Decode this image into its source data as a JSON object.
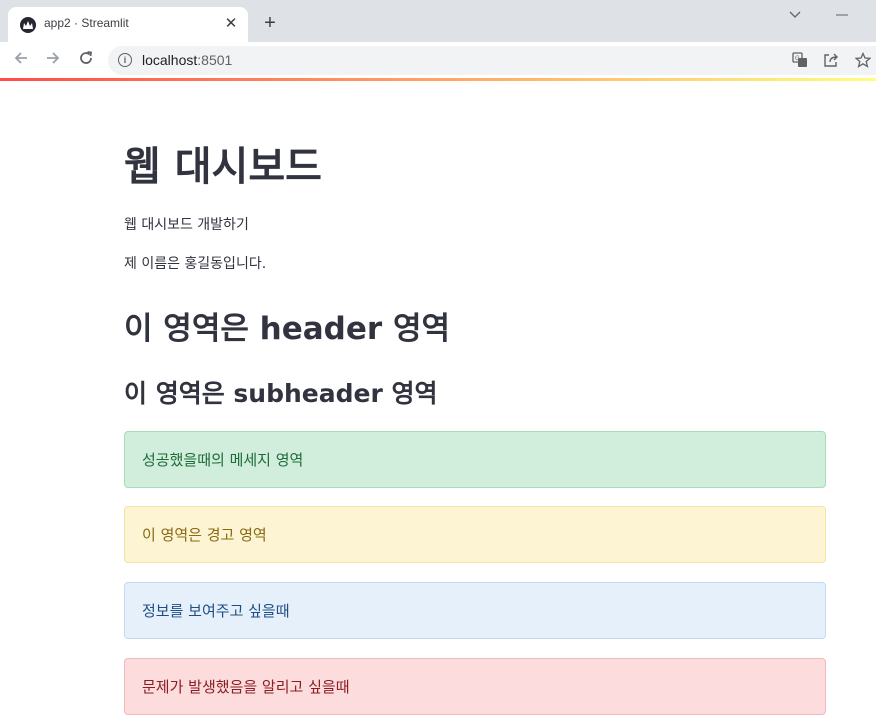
{
  "browser": {
    "tab_title": "app2 · Streamlit",
    "tab_close": "✕",
    "new_tab": "+",
    "url_host": "localhost",
    "url_port": ":8501"
  },
  "content": {
    "title": "웹 대시보드",
    "text1": "웹 대시보드 개발하기",
    "text2": "제 이름은 홍길동입니다.",
    "header": "이 영역은 header 영역",
    "subheader": "이 영역은 subheader 영역",
    "success": "성공했을때의 메세지 영역",
    "warning": "이 영역은 경고 영역",
    "info": "정보를 보여주고 싶을때",
    "error": "문제가 발생했음을 알리고 싶을때"
  },
  "colors": {
    "success_bg": "#d0eedb",
    "warning_bg": "#fdf4d3",
    "info_bg": "#e6f0fb",
    "error_bg": "#fddcdd",
    "accent": "#ff4b4b"
  },
  "icons": [
    "streamlit-favicon-icon",
    "back-arrow-icon",
    "forward-arrow-icon",
    "reload-icon",
    "info-icon",
    "translate-icon",
    "share-icon",
    "bookmark-star-icon",
    "chevron-down-icon",
    "minimize-icon",
    "close-icon",
    "plus-icon"
  ]
}
